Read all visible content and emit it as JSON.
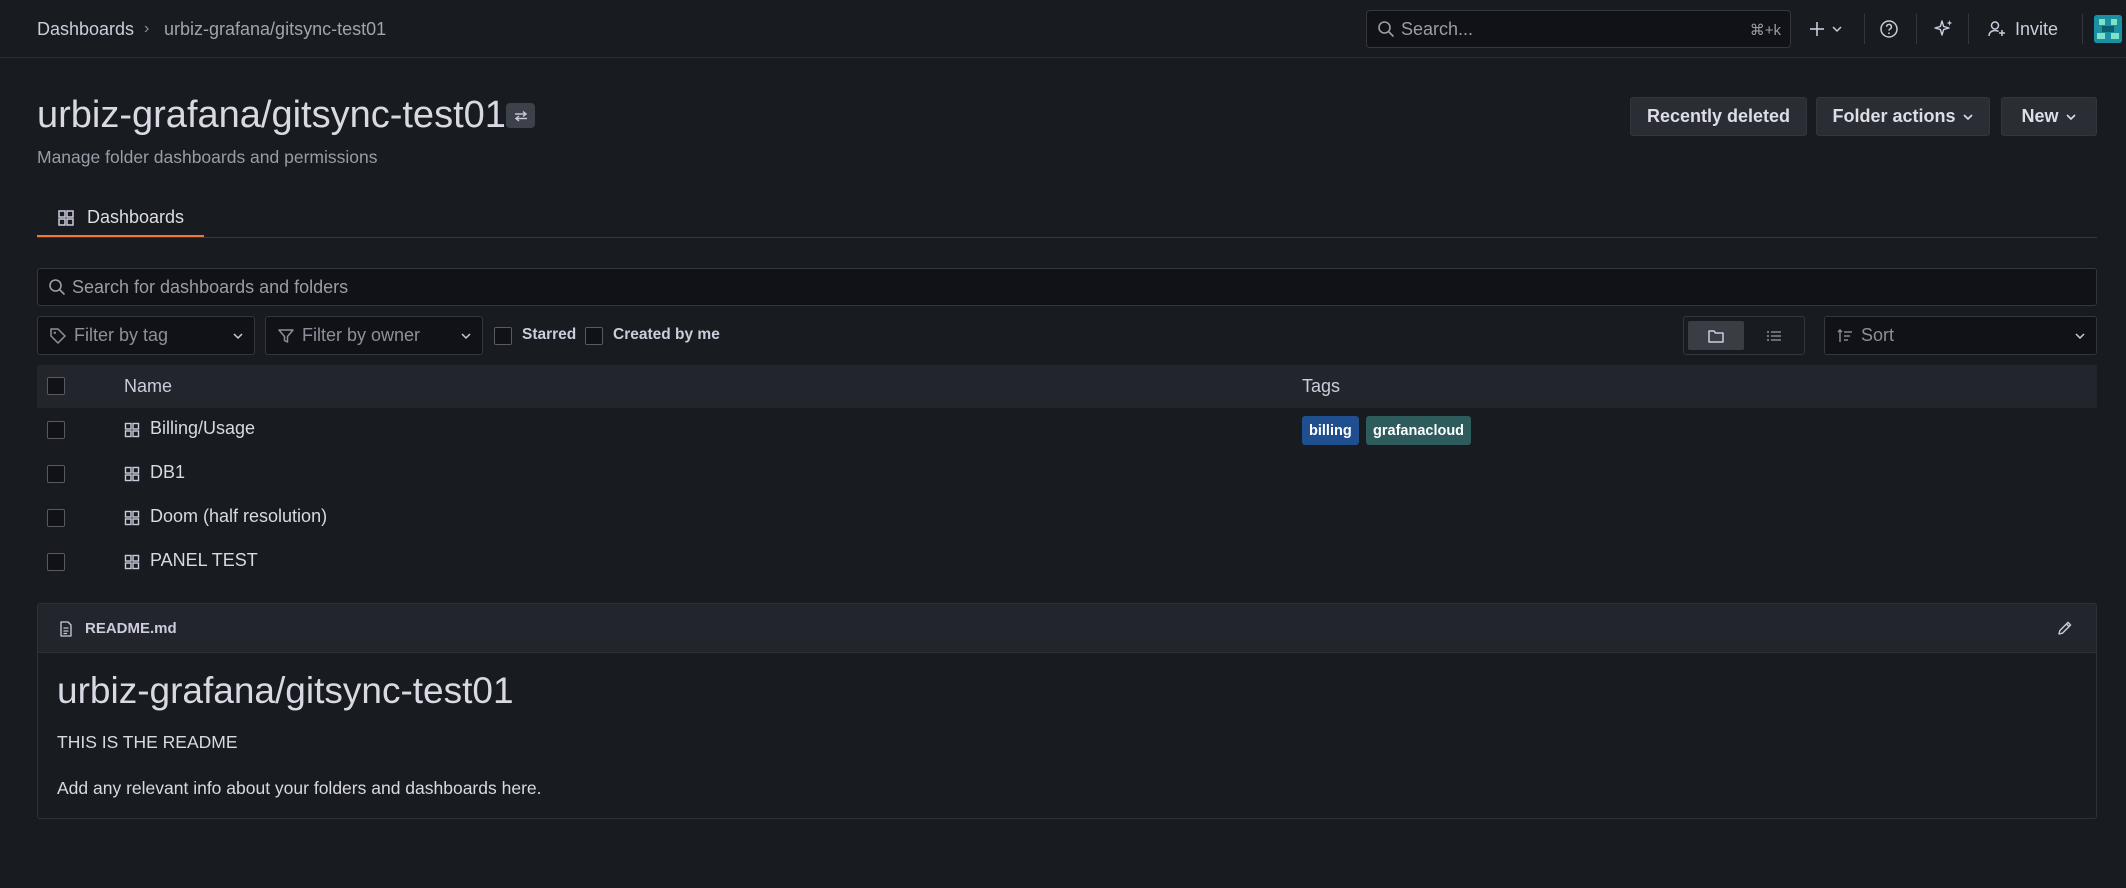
{
  "breadcrumb": {
    "home": "Dashboards",
    "separator": "›",
    "current": "urbiz-grafana/gitsync-test01"
  },
  "topbar": {
    "search_placeholder": "Search...",
    "search_shortcut": "⌘+k",
    "invite_label": "Invite"
  },
  "header": {
    "title": "urbiz-grafana/gitsync-test01",
    "subtitle": "Manage folder dashboards and permissions",
    "buttons": {
      "recently_deleted": "Recently deleted",
      "folder_actions": "Folder actions",
      "new": "New"
    }
  },
  "tabs": [
    {
      "label": "Dashboards",
      "active": true
    }
  ],
  "search": {
    "placeholder": "Search for dashboards and folders"
  },
  "filters": {
    "tag_placeholder": "Filter by tag",
    "owner_placeholder": "Filter by owner",
    "starred_label": "Starred",
    "created_by_me_label": "Created by me",
    "sort_placeholder": "Sort",
    "view_mode": "folder"
  },
  "table": {
    "columns": [
      "Name",
      "Tags"
    ],
    "rows": [
      {
        "name": "Billing/Usage",
        "tags": [
          "billing",
          "grafanacloud"
        ]
      },
      {
        "name": "DB1",
        "tags": []
      },
      {
        "name": "Doom (half resolution)",
        "tags": []
      },
      {
        "name": "PANEL TEST",
        "tags": []
      }
    ]
  },
  "tag_colors": {
    "billing": "#1f4f8f",
    "grafanacloud": "#2e5b5b"
  },
  "readme": {
    "filename": "README.md",
    "heading": "urbiz-grafana/gitsync-test01",
    "paragraph1": "THIS IS THE README",
    "paragraph2": "Add any relevant info about your folders and dashboards here."
  },
  "colors": {
    "background": "#181b1f",
    "accent": "#f07735"
  }
}
